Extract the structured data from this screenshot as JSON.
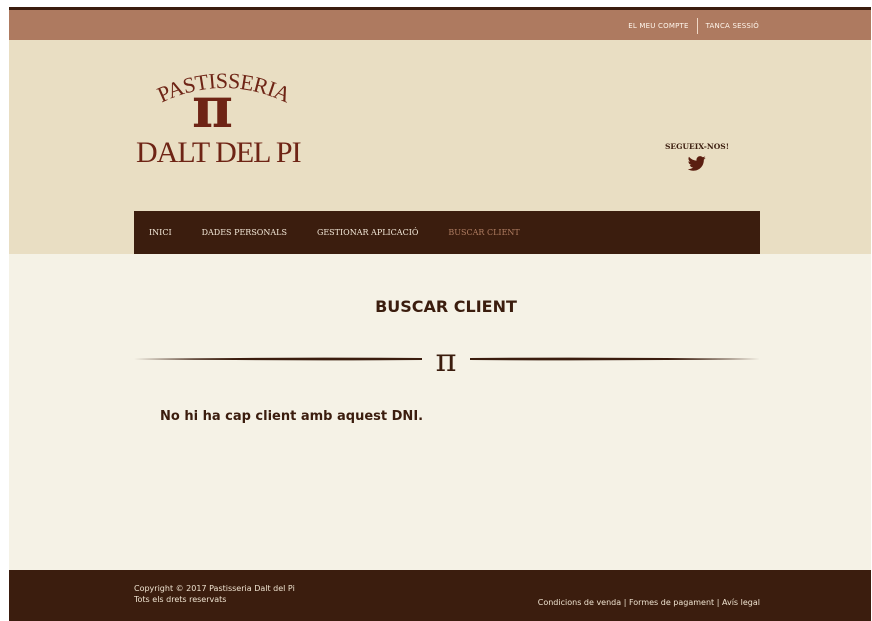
{
  "topbar": {
    "account_link": "EL MEU COMPTE",
    "logout_link": "TANCA SESSIÓ"
  },
  "logo": {
    "line1": "PASTISSERIA",
    "symbol": "π",
    "line2": "DALT DEL PI"
  },
  "social": {
    "label": "SEGUEIX-NOS!",
    "icon": "twitter-icon"
  },
  "nav": {
    "items": [
      {
        "label": "INICI"
      },
      {
        "label": "DADES PERSONALS"
      },
      {
        "label": "GESTIONAR APLICACIÓ"
      },
      {
        "label": "BUSCAR CLIENT"
      }
    ],
    "active": "BUSCAR CLIENT"
  },
  "main": {
    "title": "BUSCAR CLIENT",
    "divider_symbol": "π",
    "message": "No hi ha cap client amb aquest DNI."
  },
  "footer": {
    "copyright_line1": "Copyright © 2017 Pastisseria Dalt del Pi",
    "copyright_line2": "Tots els drets reservats",
    "links": [
      "Condicions de venda",
      "Formes de pagament",
      "Avís legal"
    ],
    "separator": "|"
  },
  "colors": {
    "dark_brown": "#3b1d0e",
    "topbar": "#ae7a60",
    "header_bg": "#e9dec3",
    "content_bg": "#f5f2e6",
    "logo": "#6e2415",
    "nav_active": "#b07d62"
  }
}
